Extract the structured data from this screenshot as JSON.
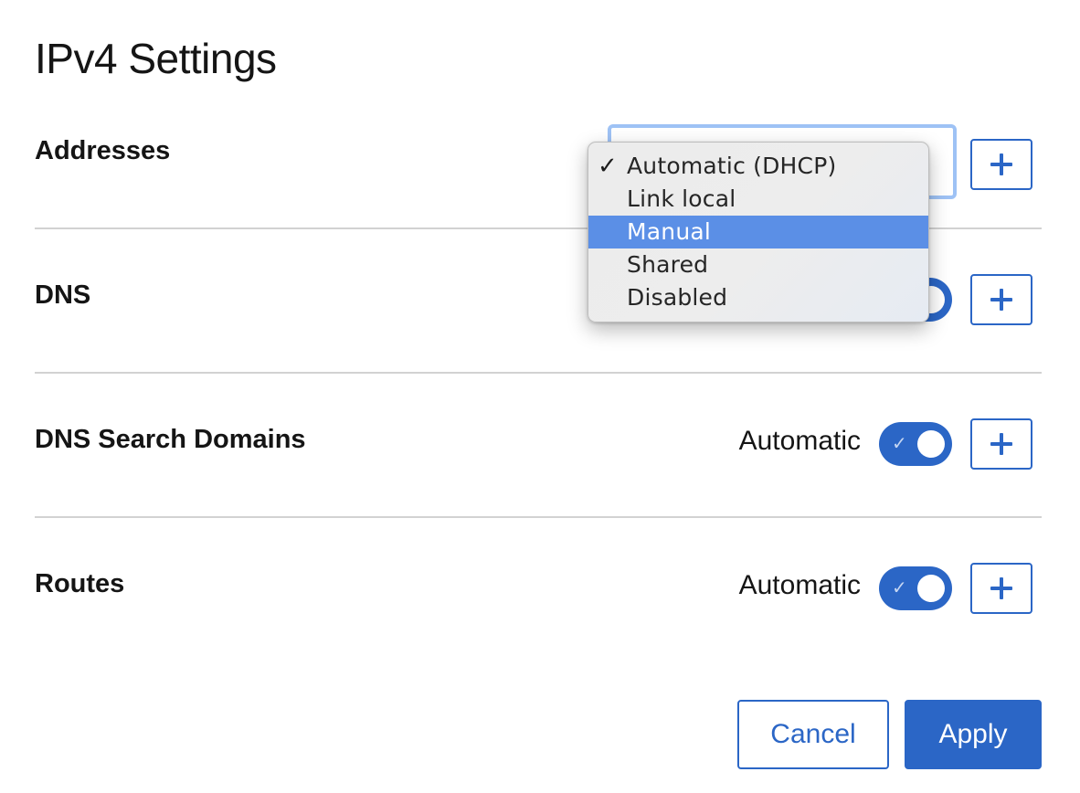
{
  "dialog": {
    "title": "IPv4 Settings"
  },
  "rows": [
    {
      "label": "Addresses",
      "add_icon": "plus-icon"
    },
    {
      "label": "DNS",
      "toggle_on": true,
      "add_icon": "plus-icon"
    },
    {
      "label": "DNS Search Domains",
      "toggle_label": "Automatic",
      "toggle_on": true,
      "add_icon": "plus-icon"
    },
    {
      "label": "Routes",
      "toggle_label": "Automatic",
      "toggle_on": true,
      "add_icon": "plus-icon"
    }
  ],
  "method_dropdown": {
    "options": [
      {
        "label": "Automatic (DHCP)",
        "checked": true
      },
      {
        "label": "Link local"
      },
      {
        "label": "Manual",
        "highlighted": true
      },
      {
        "label": "Shared"
      },
      {
        "label": "Disabled"
      }
    ],
    "check_glyph": "✓"
  },
  "footer": {
    "cancel_label": "Cancel",
    "apply_label": "Apply"
  },
  "colors": {
    "accent": "#2b66c6",
    "highlight": "#5b8fe6",
    "focus_ring": "#9ec2f5",
    "divider": "#d2d2d2"
  }
}
